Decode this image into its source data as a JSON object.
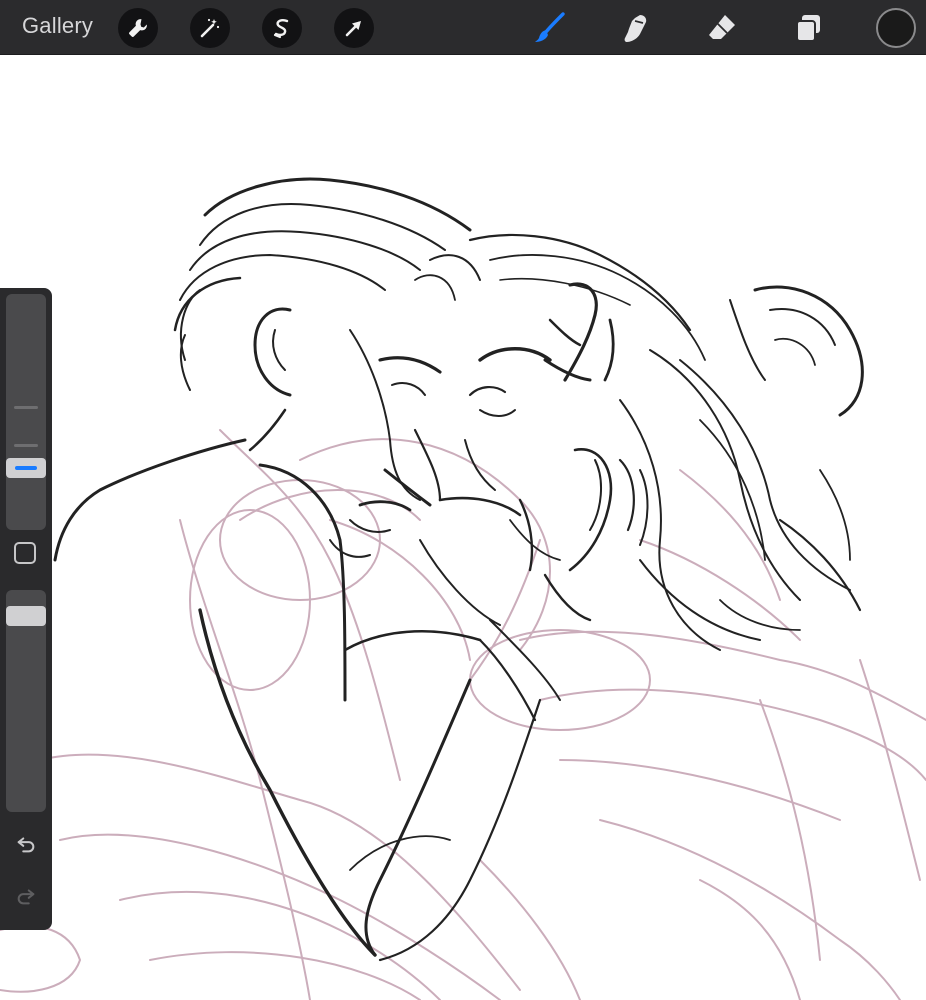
{
  "toolbar": {
    "gallery_label": "Gallery",
    "left_tools": [
      "wrench-icon",
      "magic-wand-icon",
      "selection-icon",
      "transform-arrow-icon"
    ],
    "right_tools": [
      "brush-icon",
      "smudge-icon",
      "eraser-icon",
      "layers-icon"
    ],
    "active_tool": "brush-icon",
    "accent_color": "#1a7cff",
    "current_color": "#1a1a1a"
  },
  "sidebar": {
    "brush_size_level": 0.3,
    "opacity_level": 0.9,
    "controls": [
      "brush-size-slider",
      "modify-button",
      "opacity-slider",
      "undo-button",
      "redo-button"
    ]
  },
  "canvas": {
    "ink_color": "#222222",
    "sketch_color": "#c9a9b8"
  }
}
